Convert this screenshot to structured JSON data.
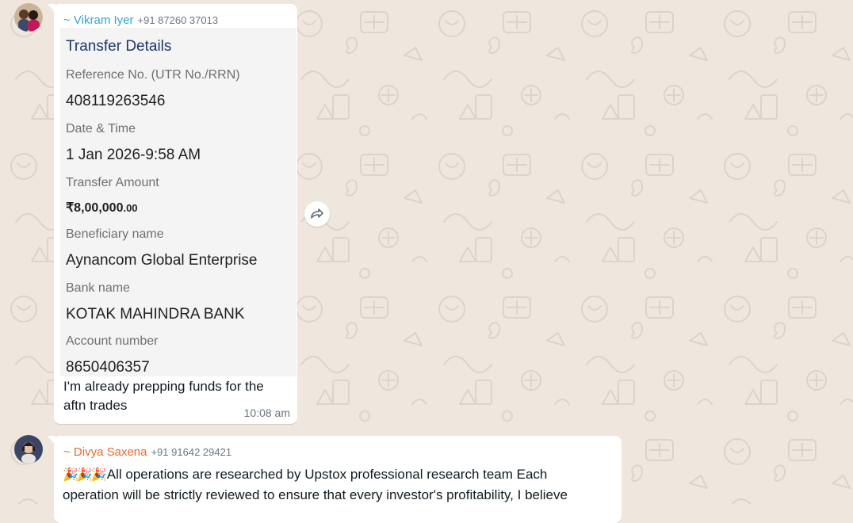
{
  "colors": {
    "wallpaper": "#efe7de",
    "bubble": "#ffffff",
    "sender1_name": "#35a4d6",
    "sender2_name": "#e96a2e",
    "receipt_title": "#1d3a6b"
  },
  "messages": [
    {
      "sender_name": "~ Vikram Iyer",
      "sender_phone": "+91 87260 37013",
      "avatar": "couple-photo-avatar",
      "receipt": {
        "title": "Transfer Details",
        "fields": [
          {
            "label": "Reference No. (UTR No./RRN)",
            "value": "408119263546"
          },
          {
            "label": "Date & Time",
            "value": "1 Jan 2026-9:58 AM"
          },
          {
            "label": "Transfer Amount",
            "value_main": "₹8,00,000",
            "value_decimal": ".00"
          },
          {
            "label": "Beneficiary name",
            "value": "Aynancom Global Enterprise"
          },
          {
            "label": "Bank name",
            "value": "KOTAK MAHINDRA BANK"
          },
          {
            "label": "Account number",
            "value": "8650406357"
          }
        ]
      },
      "caption_line1": "I'm already prepping funds for the",
      "caption_line2": "aftn trades",
      "time": "10:08 am",
      "forward_icon": "forward-icon"
    },
    {
      "sender_name": "~ Divya Saxena",
      "sender_phone": "+91 91642 29421",
      "avatar": "woman-photo-avatar",
      "emoji": "🎉🎉🎉",
      "text_line1": "All operations are researched by Upstox professional research team Each",
      "text_line2": "operation will be strictly reviewed to ensure that every investor's profitability, I believe"
    }
  ]
}
